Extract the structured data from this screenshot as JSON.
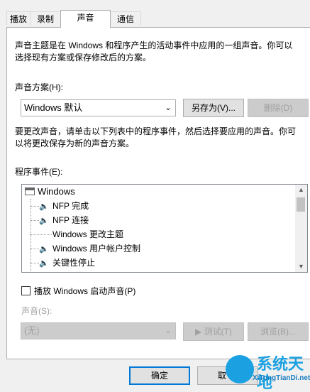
{
  "tabs": [
    {
      "label": "播放"
    },
    {
      "label": "录制"
    },
    {
      "label": "声音"
    },
    {
      "label": "通信"
    }
  ],
  "intro": {
    "line1": "声音主题是在 Windows 和程序产生的活动事件中应用的一组声音。你可以",
    "line2": "选择现有方案或保存修改后的方案。"
  },
  "scheme": {
    "label": "声音方案(H):",
    "value": "Windows 默认",
    "save_as": "另存为(V)...",
    "delete": "删除(D)"
  },
  "instructions": {
    "line1": "要更改声音，请单击以下列表中的程序事件，然后选择要应用的声音。你可",
    "line2": "以将更改保存为新的声音方案。"
  },
  "events": {
    "label": "程序事件(E):",
    "items": [
      {
        "label": "Windows",
        "icon": "window-icon"
      },
      {
        "label": "NFP 完成",
        "icon": "speaker-icon"
      },
      {
        "label": "NFP 连接",
        "icon": "speaker-icon"
      },
      {
        "label": "Windows 更改主题",
        "icon": ""
      },
      {
        "label": "Windows 用户帐户控制",
        "icon": "speaker-icon"
      },
      {
        "label": "关键性停止",
        "icon": "speaker-icon"
      }
    ]
  },
  "startup": {
    "label": "播放 Windows 启动声音(P)",
    "checked": false
  },
  "sound": {
    "label": "声音(S):",
    "value": "(无)",
    "test": "▶ 测试(T)",
    "browse": "浏览(B)..."
  },
  "footer": {
    "ok": "确定",
    "cancel_partial": "取"
  },
  "watermark": {
    "title": "系统天地",
    "url": "XiTongTianDi.net"
  },
  "colors": {
    "accent": "#0078d7",
    "watermark": "#1ba1e2"
  }
}
